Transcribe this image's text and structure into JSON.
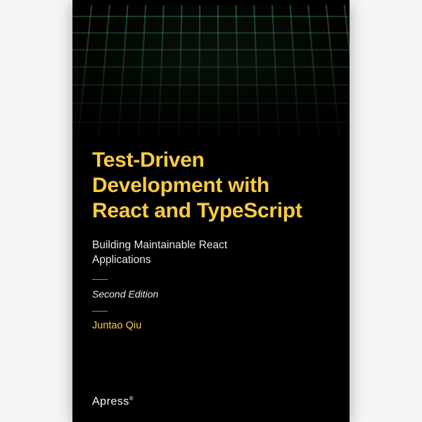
{
  "cover": {
    "title": "Test-Driven Development with React and TypeScript",
    "subtitle": "Building Maintainable React Applications",
    "edition": "Second Edition",
    "author": "Juntao Qiu",
    "publisher": "Apress",
    "publisher_mark": "®",
    "accent_color": "#f7cb3f",
    "background_color": "#000000"
  }
}
